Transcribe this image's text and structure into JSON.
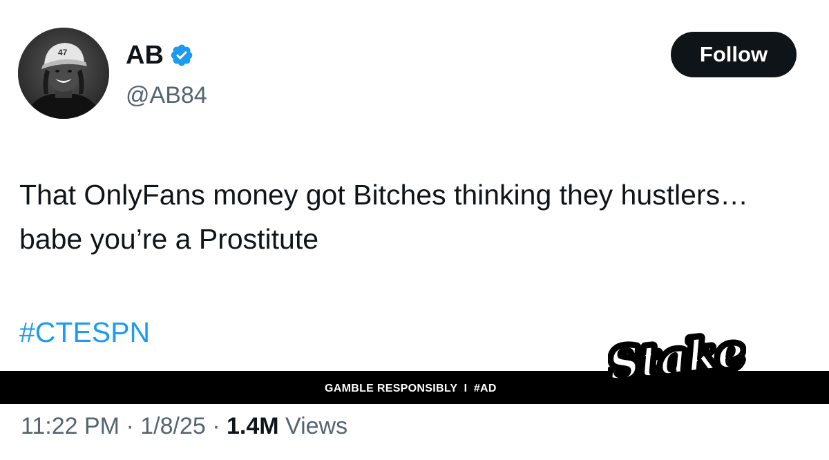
{
  "author": {
    "display_name": "AB",
    "handle": "@AB84",
    "verified": true,
    "avatar_icon": "profile-photo",
    "cap_text": "47"
  },
  "actions": {
    "follow_label": "Follow"
  },
  "tweet": {
    "text": "That OnlyFans money got Bitches thinking they hustlers… babe you’re a Prostitute",
    "hashtag": "#CTESPN"
  },
  "ad": {
    "disclaimer": "GAMBLE RESPONSIBLY  I  #AD",
    "brand": "Stake"
  },
  "meta": {
    "time": "11:22 PM",
    "sep1": " · ",
    "date": "1/8/25",
    "sep2": " · ",
    "views_count": "1.4M",
    "views_label": " Views"
  },
  "colors": {
    "accent_blue": "#1d9bf0",
    "text_primary": "#0f1419",
    "text_secondary": "#536471",
    "follow_bg": "#0f1419",
    "ad_band": "#000000"
  }
}
